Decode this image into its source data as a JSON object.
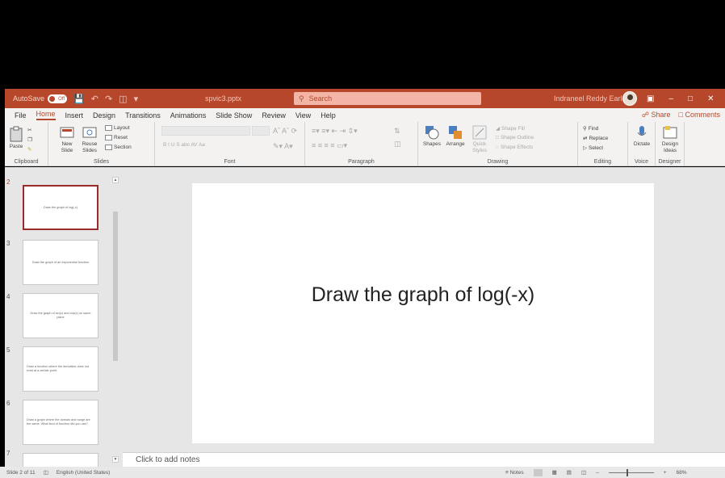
{
  "colors": {
    "accent": "#b7472a",
    "ribbon": "#f3f2f1",
    "canvas": "#e6e6e6"
  },
  "titlebar": {
    "autosave_label": "AutoSave",
    "autosave_state": "Off",
    "file_name": "spvic3.pptx",
    "search_placeholder": "Search",
    "user_name": "Indraneel Reddy Earle"
  },
  "tabs": [
    "File",
    "Home",
    "Insert",
    "Design",
    "Transitions",
    "Animations",
    "Slide Show",
    "Review",
    "View",
    "Help"
  ],
  "share_label": "Share",
  "comments_label": "Comments",
  "ribbon": {
    "clipboard": {
      "paste": "Paste",
      "label": "Clipboard"
    },
    "slides": {
      "new_slide": "New Slide",
      "reuse_slides": "Reuse Slides",
      "layout": "Layout",
      "reset": "Reset",
      "section": "Section",
      "label": "Slides"
    },
    "font": {
      "label": "Font",
      "format_row": "B  I  U  S  abc  AV  Aa"
    },
    "paragraph": {
      "label": "Paragraph"
    },
    "drawing": {
      "shapes": "Shapes",
      "arrange": "Arrange",
      "quick_styles": "Quick Styles",
      "shape_fill": "Shape Fill",
      "shape_outline": "Shape Outline",
      "shape_effects": "Shape Effects",
      "label": "Drawing"
    },
    "editing": {
      "find": "Find",
      "replace": "Replace",
      "select": "Select",
      "label": "Editing"
    },
    "voice": {
      "dictate": "Dictate",
      "label": "Voice"
    },
    "designer": {
      "design_ideas": "Design Ideas",
      "label": "Designer"
    }
  },
  "slides": [
    {
      "num": "2",
      "text": "Draw the graph of log(-x)"
    },
    {
      "num": "3",
      "text": "Draw the graph of an exponential function"
    },
    {
      "num": "4",
      "text": "Draw the graph of sin(x) and cos(x) on same plane"
    },
    {
      "num": "5",
      "text": "Draw a function where the derivative does not exist at a certain point."
    },
    {
      "num": "6",
      "text": "Draw a graph where the domain and range are the same. What kind of function did you use?"
    },
    {
      "num": "7",
      "text": ""
    }
  ],
  "current_slide": {
    "title": "Draw the graph of log(-x)"
  },
  "notes_placeholder": "Click to add notes",
  "status": {
    "slide_counter": "Slide 2 of 11",
    "language": "English (United States)",
    "notes_label": "Notes",
    "zoom": "68%"
  }
}
